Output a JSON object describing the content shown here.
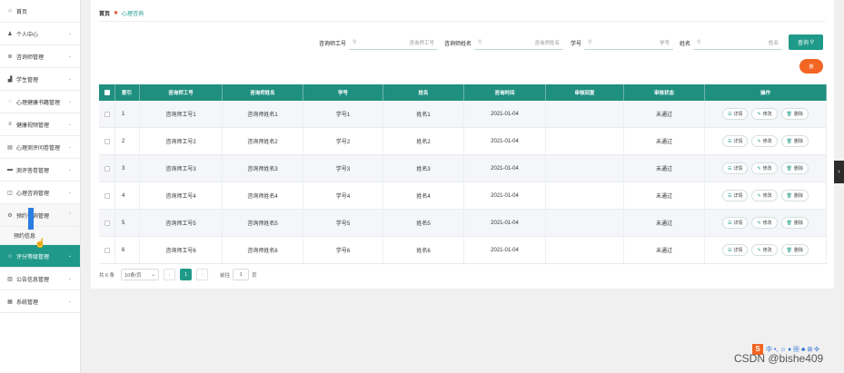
{
  "sidebar": {
    "items": [
      {
        "label": "首页",
        "icon": "home-icon",
        "glyph": "⌂",
        "chev": ""
      },
      {
        "label": "个人中心",
        "icon": "user-icon",
        "glyph": "♟",
        "chev": "⌄"
      },
      {
        "label": "咨询师管理",
        "icon": "list-icon",
        "glyph": "≣",
        "chev": "⌄"
      },
      {
        "label": "学生管理",
        "icon": "chart-icon",
        "glyph": "▟",
        "chev": "⌄"
      },
      {
        "label": "心理健康书籍管理",
        "icon": "chat-icon",
        "glyph": "◌",
        "chev": "⌄"
      },
      {
        "label": "健康视频管理",
        "icon": "menu-icon",
        "glyph": "≡",
        "chev": "⌄"
      },
      {
        "label": "心理测评问卷管理",
        "icon": "doc-icon",
        "glyph": "▤",
        "chev": "⌄"
      },
      {
        "label": "测评答卷管理",
        "icon": "table-icon",
        "glyph": "▬",
        "chev": "⌄"
      },
      {
        "label": "心理咨询管理",
        "icon": "msg-icon",
        "glyph": "◫",
        "chev": "⌄"
      },
      {
        "label": "预约咨询管理",
        "icon": "settings-icon",
        "glyph": "⚙",
        "chev": "⌃"
      }
    ],
    "sub_item": "预约信息",
    "after_items": [
      {
        "label": "评分等级管理",
        "icon": "star-icon",
        "glyph": "☆",
        "chev": "⌄",
        "active": true
      },
      {
        "label": "公告信息管理",
        "icon": "notice-icon",
        "glyph": "▥",
        "chev": "⌄"
      },
      {
        "label": "系统管理",
        "icon": "system-icon",
        "glyph": "▦",
        "chev": "⌄"
      }
    ]
  },
  "breadcrumb": {
    "home": "首页",
    "current": "心理咨询"
  },
  "search": {
    "fields": [
      {
        "label": "咨询师工号",
        "placeholder": "咨询师工号"
      },
      {
        "label": "咨询师姓名",
        "placeholder": "咨询师姓名"
      },
      {
        "label": "学号",
        "placeholder": "学号"
      },
      {
        "label": "姓名",
        "placeholder": "姓名"
      }
    ],
    "query_button": "查询"
  },
  "delete_button": "删",
  "table": {
    "headers": [
      "",
      "索引",
      "咨询师工号",
      "咨询师姓名",
      "学号",
      "姓名",
      "咨询时间",
      "审核回复",
      "审核状态",
      "操作"
    ],
    "rows": [
      [
        "1",
        "咨询师工号1",
        "咨询师姓名1",
        "学号1",
        "姓名1",
        "2021-01-04",
        "",
        "未通过"
      ],
      [
        "2",
        "咨询师工号2",
        "咨询师姓名2",
        "学号2",
        "姓名2",
        "2021-01-04",
        "",
        "未通过"
      ],
      [
        "3",
        "咨询师工号3",
        "咨询师姓名3",
        "学号3",
        "姓名3",
        "2021-01-04",
        "",
        "未通过"
      ],
      [
        "4",
        "咨询师工号4",
        "咨询师姓名4",
        "学号4",
        "姓名4",
        "2021-01-04",
        "",
        "未通过"
      ],
      [
        "5",
        "咨询师工号5",
        "咨询师姓名5",
        "学号5",
        "姓名5",
        "2021-01-04",
        "",
        "未通过"
      ],
      [
        "6",
        "咨询师工号6",
        "咨询师姓名6",
        "学号6",
        "姓名6",
        "2021-01-04",
        "",
        "未通过"
      ]
    ],
    "actions": [
      "详情",
      "修改",
      "删除"
    ]
  },
  "pager": {
    "total": "共 6 条",
    "page_size": "10条/页",
    "current_page": "1",
    "goto_label": "前往",
    "goto_value": "1",
    "page_unit": "页"
  },
  "side_tab": "‹",
  "ime": {
    "s": "S",
    "items": "中 •, ☺ ♦ ▦ ♣ ⊞ ✣"
  },
  "watermark": "CSDN @bishe409"
}
